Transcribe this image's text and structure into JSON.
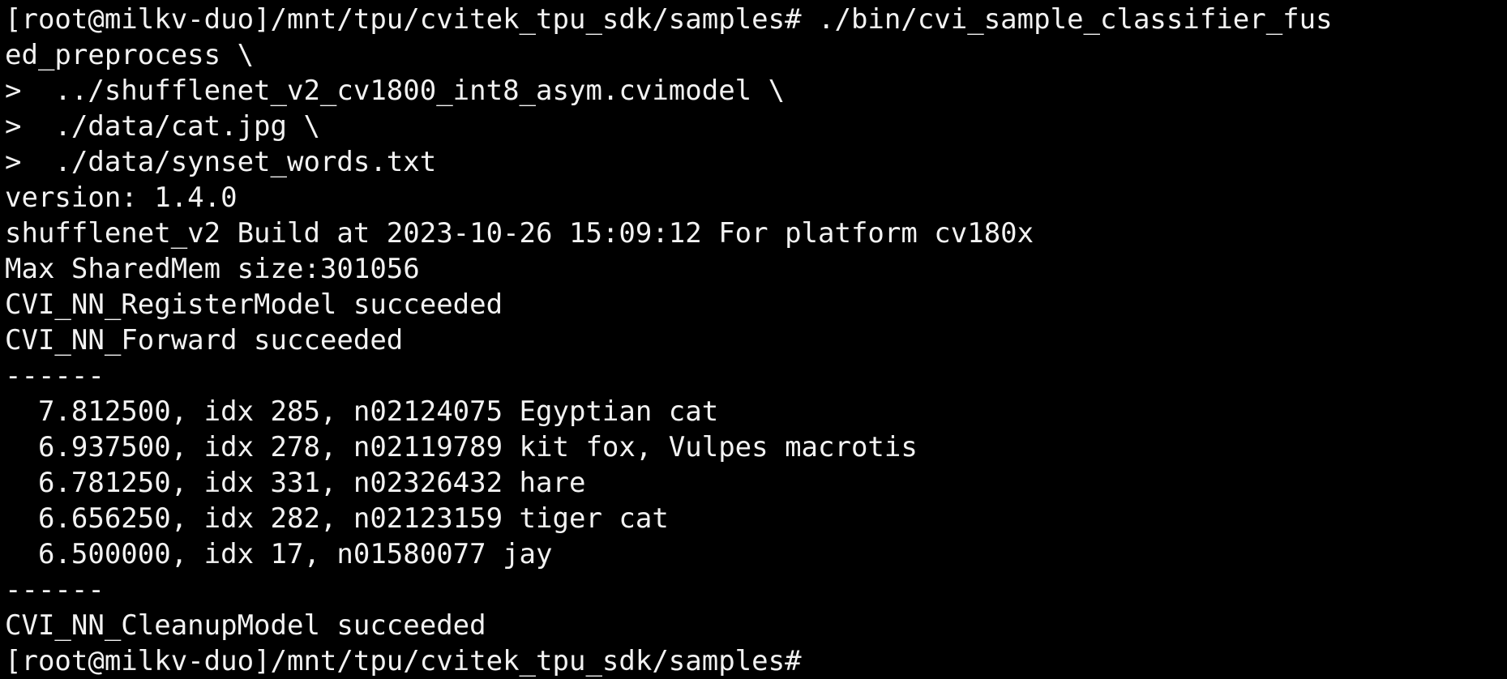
{
  "terminal": {
    "lines": [
      "[root@milkv-duo]/mnt/tpu/cvitek_tpu_sdk/samples# ./bin/cvi_sample_classifier_fus",
      "ed_preprocess \\",
      ">  ../shufflenet_v2_cv1800_int8_asym.cvimodel \\",
      ">  ./data/cat.jpg \\",
      ">  ./data/synset_words.txt",
      "version: 1.4.0",
      "shufflenet_v2 Build at 2023-10-26 15:09:12 For platform cv180x",
      "Max SharedMem size:301056",
      "CVI_NN_RegisterModel succeeded",
      "CVI_NN_Forward succeeded",
      "------",
      "  7.812500, idx 285, n02124075 Egyptian cat",
      "  6.937500, idx 278, n02119789 kit fox, Vulpes macrotis",
      "  6.781250, idx 331, n02326432 hare",
      "  6.656250, idx 282, n02123159 tiger cat",
      "  6.500000, idx 17, n01580077 jay",
      "------",
      "CVI_NN_CleanupModel succeeded",
      "[root@milkv-duo]/mnt/tpu/cvitek_tpu_sdk/samples#"
    ]
  }
}
